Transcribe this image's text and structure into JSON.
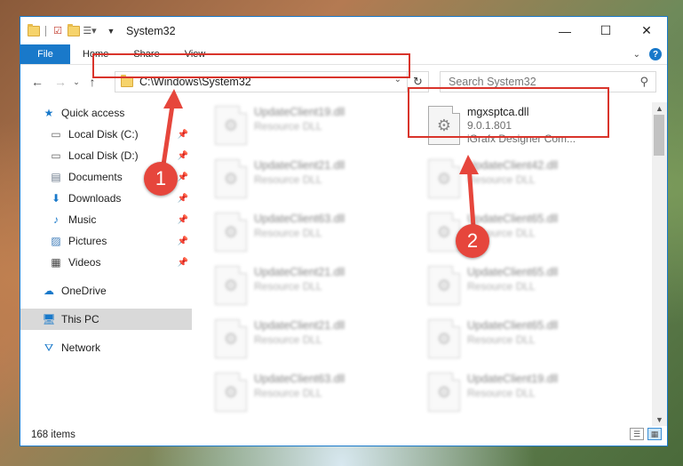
{
  "window": {
    "title": "System32",
    "controls": {
      "minimize": "—",
      "maximize": "☐",
      "close": "✕"
    }
  },
  "ribbon": {
    "tabs": [
      "File",
      "Home",
      "Share",
      "View"
    ],
    "expand_icon": "chevron-down-icon",
    "help_label": "?"
  },
  "address": {
    "path": "C:\\Windows\\System32",
    "search_placeholder": "Search System32"
  },
  "sidebar": {
    "quick_access": "Quick access",
    "items": [
      {
        "label": "Local Disk (C:)",
        "icon": "drive-icon",
        "pinned": true
      },
      {
        "label": "Local Disk (D:)",
        "icon": "drive-icon",
        "pinned": true
      },
      {
        "label": "Documents",
        "icon": "documents-icon",
        "pinned": true
      },
      {
        "label": "Downloads",
        "icon": "downloads-icon",
        "pinned": true
      },
      {
        "label": "Music",
        "icon": "music-icon",
        "pinned": true
      },
      {
        "label": "Pictures",
        "icon": "pictures-icon",
        "pinned": true
      },
      {
        "label": "Videos",
        "icon": "videos-icon",
        "pinned": true
      }
    ],
    "onedrive": "OneDrive",
    "this_pc": "This PC",
    "network": "Network"
  },
  "files": {
    "left": [
      {
        "name": "UpdateClient19.dll",
        "type": "Resource DLL"
      },
      {
        "name": "UpdateClient21.dll",
        "type": "Resource DLL"
      },
      {
        "name": "UpdateClient63.dll",
        "type": "Resource DLL"
      },
      {
        "name": "UpdateClient21.dll",
        "type": "Resource DLL"
      },
      {
        "name": "UpdateClient21.dll",
        "type": "Resource DLL"
      },
      {
        "name": "UpdateClient63.dll",
        "type": "Resource DLL"
      }
    ],
    "right": [
      {
        "name": "mgxsptca.dll",
        "version": "9.0.1.801",
        "company": "iGrafx Designer Com..."
      },
      {
        "name": "UpdateClient42.dll",
        "type": "Resource DLL"
      },
      {
        "name": "UpdateClient65.dll",
        "type": "Resource DLL"
      },
      {
        "name": "UpdateClient65.dll",
        "type": "Resource DLL"
      },
      {
        "name": "UpdateClient65.dll",
        "type": "Resource DLL"
      },
      {
        "name": "UpdateClient19.dll",
        "type": "Resource DLL"
      }
    ]
  },
  "status": {
    "items": "168 items"
  },
  "callouts": [
    "1",
    "2"
  ],
  "colors": {
    "accent": "#1979ca",
    "highlight": "#d9342b",
    "callout": "#e6463c"
  }
}
